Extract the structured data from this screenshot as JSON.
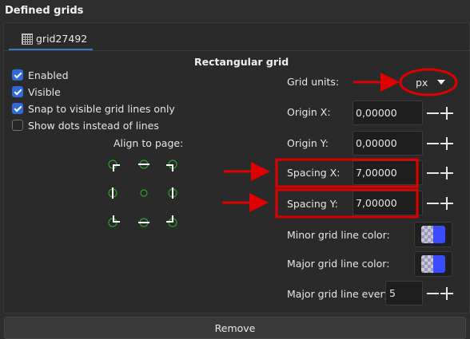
{
  "section": {
    "title": "Defined grids"
  },
  "tab": {
    "label": "grid27492",
    "icon": "grid-icon"
  },
  "panel": {
    "title": "Rectangular grid"
  },
  "checkboxes": [
    {
      "label": "Enabled",
      "checked": true
    },
    {
      "label": "Visible",
      "checked": true
    },
    {
      "label": "Snap to visible grid lines only",
      "checked": true
    },
    {
      "label": "Show dots instead of lines",
      "checked": false
    }
  ],
  "align": {
    "label": "Align to page:"
  },
  "fields": {
    "grid_units": {
      "label": "Grid units:",
      "value": "px"
    },
    "origin_x": {
      "label": "Origin X:",
      "value": "0,00000"
    },
    "origin_y": {
      "label": "Origin Y:",
      "value": "0,00000"
    },
    "spacing_x": {
      "label": "Spacing X:",
      "value": "7,00000"
    },
    "spacing_y": {
      "label": "Spacing Y:",
      "value": "7,00000"
    },
    "minor_color": {
      "label": "Minor grid line color:",
      "color": "#3b4cff"
    },
    "major_color": {
      "label": "Major grid line color:",
      "color": "#3b4cff"
    },
    "major_every": {
      "label": "Major grid line every:",
      "value": "5"
    }
  },
  "remove_button": {
    "label": "Remove"
  },
  "colors": {
    "accent": "#2f6ad8",
    "annotation": "#e00000",
    "align_point": "#2aa02a"
  }
}
